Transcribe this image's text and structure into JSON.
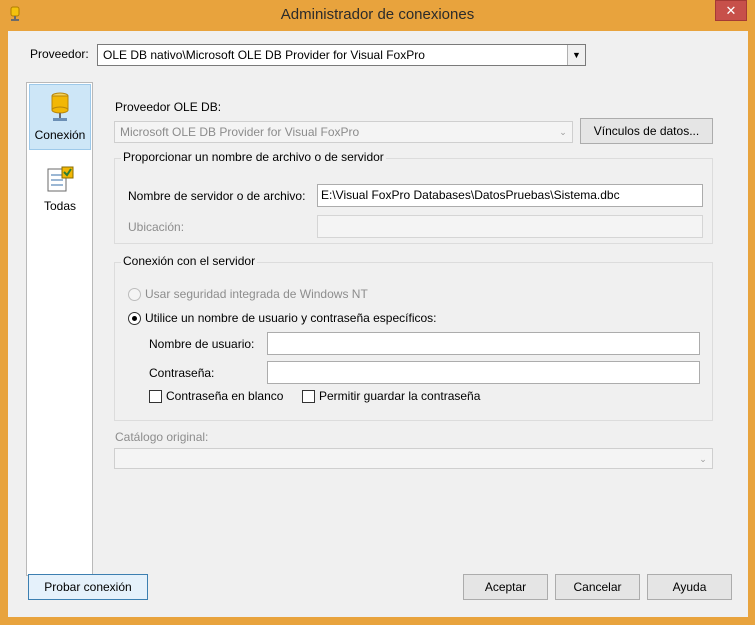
{
  "window": {
    "title": "Administrador de conexiones",
    "close_label": "✕"
  },
  "provider": {
    "label": "Proveedor:",
    "value": "OLE DB nativo\\Microsoft OLE DB Provider for Visual FoxPro",
    "arrow": "▼"
  },
  "nav": {
    "items": [
      {
        "label": "Conexión",
        "icon": "database-icon",
        "selected": true
      },
      {
        "label": "Todas",
        "icon": "properties-list-icon",
        "selected": false
      }
    ]
  },
  "ole_db": {
    "label": "Proveedor OLE DB:",
    "value": "Microsoft OLE DB Provider for Visual FoxPro",
    "arrow": "⌄",
    "data_links_button": "Vínculos de datos..."
  },
  "server_group": {
    "title": "Proporcionar un nombre de archivo o de servidor",
    "server_label": "Nombre de servidor o de archivo:",
    "server_value": "E:\\Visual FoxPro Databases\\DatosPruebas\\Sistema.dbc",
    "location_label": "Ubicación:",
    "location_value": ""
  },
  "auth_group": {
    "title": "Conexión con el servidor",
    "windows_auth_label": "Usar seguridad integrada de Windows NT",
    "specific_auth_label": "Utilice un nombre de usuario y contraseña específicos:",
    "selected": "specific",
    "username_label": "Nombre de usuario:",
    "username_value": "",
    "password_label": "Contraseña:",
    "password_value": "",
    "blank_password_label": "Contraseña en blanco",
    "blank_password_checked": false,
    "save_password_label": "Permitir guardar la contraseña",
    "save_password_checked": false
  },
  "catalog": {
    "label": "Catálogo original:",
    "value": "",
    "arrow": "⌄"
  },
  "footer": {
    "test_button": "Probar conexión",
    "ok_button": "Aceptar",
    "cancel_button": "Cancelar",
    "help_button": "Ayuda"
  },
  "colors": {
    "title_bar": "#e8a33d",
    "close_button": "#c7504a",
    "selected_nav": "#cde6f7",
    "focus_border": "#3c7fb1"
  }
}
